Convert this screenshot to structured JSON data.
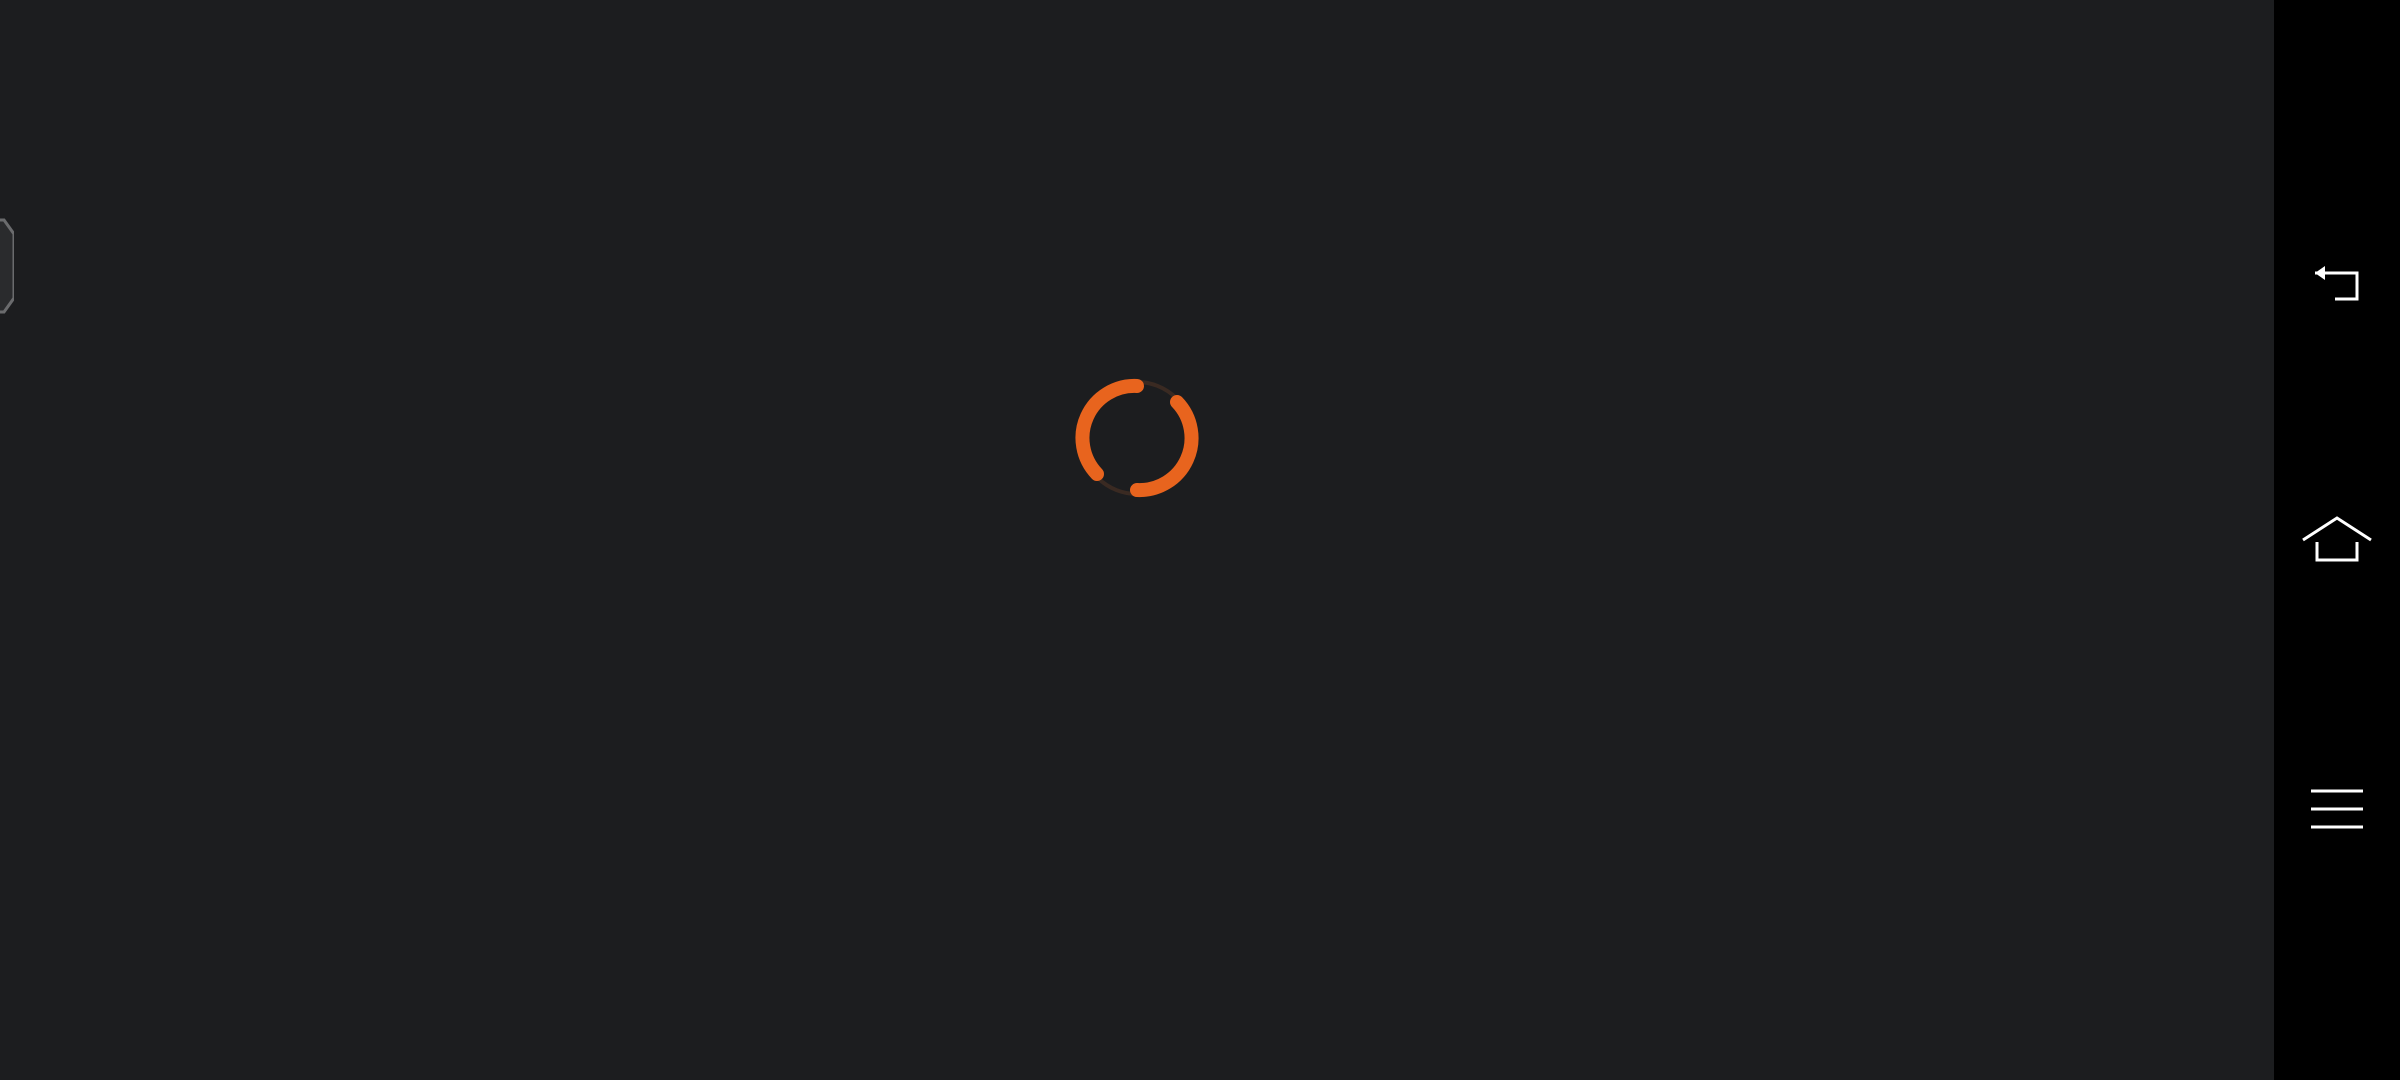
{
  "screen": {
    "state": "loading",
    "background_color": "#1c1d1f"
  },
  "spinner": {
    "icon": "loading-spinner-icon",
    "color": "#e8641e"
  },
  "edge_handle": {
    "icon": "edge-panel-handle-icon",
    "color": "#6a6b6d"
  },
  "navigation_bar": {
    "background_color": "#000000",
    "icon_color": "#ffffff",
    "buttons": [
      {
        "id": "back",
        "icon": "back-icon"
      },
      {
        "id": "home",
        "icon": "home-icon"
      },
      {
        "id": "recents",
        "icon": "recents-icon"
      }
    ]
  }
}
